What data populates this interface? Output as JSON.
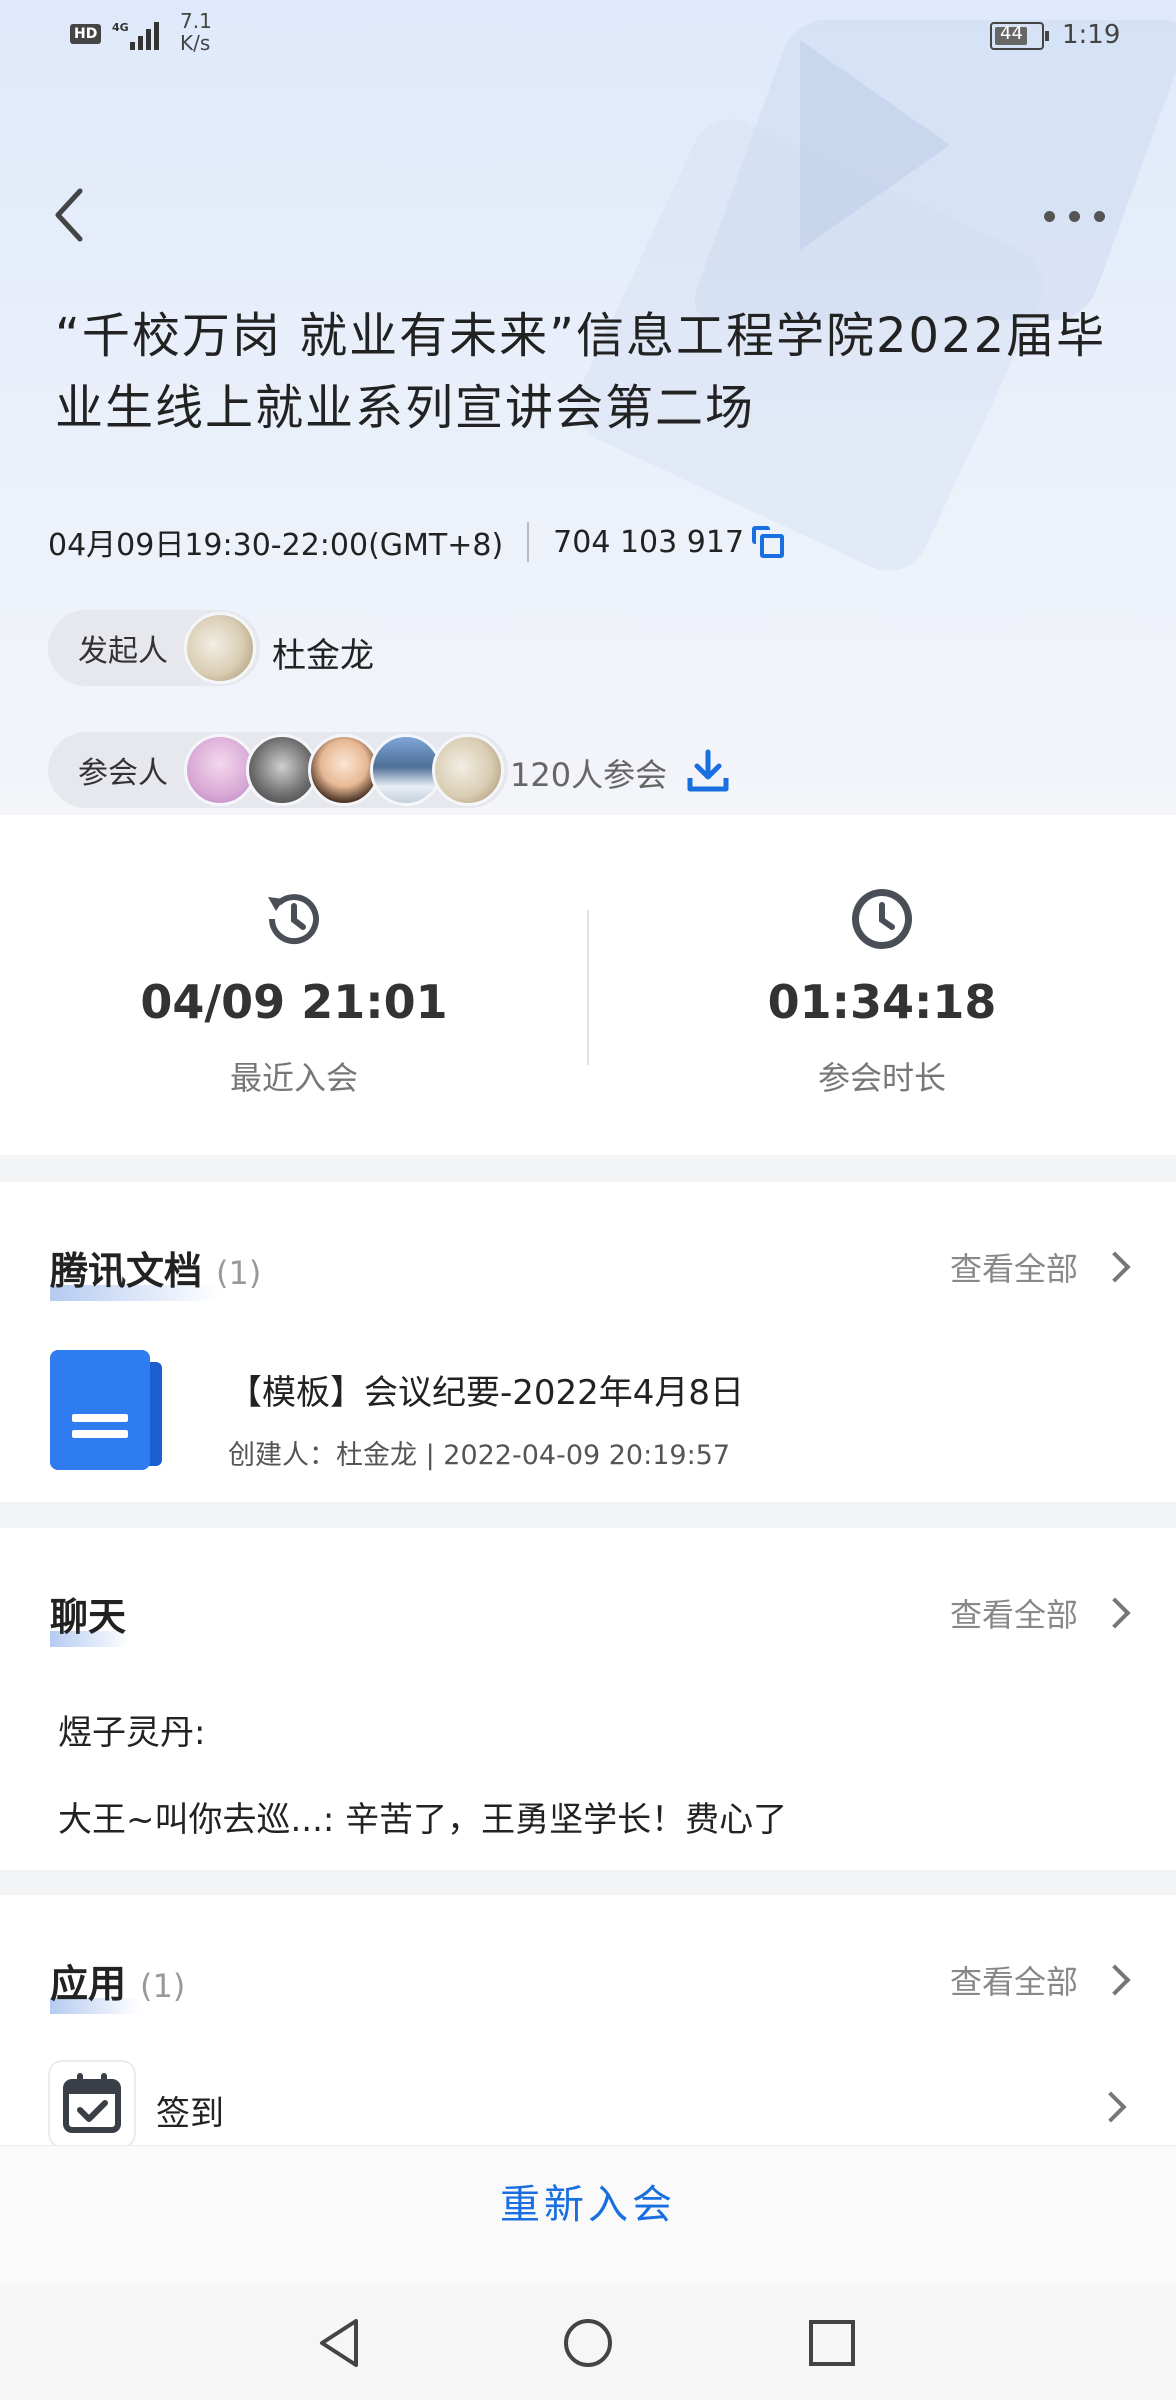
{
  "status_bar": {
    "hd": "HD",
    "network": "4G",
    "speed_value": "7.1",
    "speed_unit": "K/s",
    "battery_level": "44",
    "time": "1:19"
  },
  "meeting": {
    "title": "“千校万岗 就业有未来”信息工程学院2022届毕业生线上就业系列宣讲会第二场",
    "time_range": "04月09日19:30-22:00(GMT+8)",
    "meeting_id": "704 103 917",
    "host_label": "发起人",
    "host_name": "杜金龙",
    "participants_label": "参会人",
    "participant_count": "120人参会"
  },
  "stats": {
    "recent_join_value": "04/09 21:01",
    "recent_join_label": "最近入会",
    "duration_value": "01:34:18",
    "duration_label": "参会时长"
  },
  "docs": {
    "title": "腾讯文档",
    "count": "(1)",
    "view_all": "查看全部",
    "items": [
      {
        "name": "【模板】会议纪要-2022年4月8日",
        "meta": "创建人：杜金龙 | 2022-04-09 20:19:57"
      }
    ]
  },
  "chat": {
    "title": "聊天",
    "view_all": "查看全部",
    "messages": [
      "煜子灵丹:",
      "大王~叫你去巡...: 辛苦了，王勇坚学长！费心了"
    ]
  },
  "apps": {
    "title": "应用",
    "count": "(1)",
    "view_all": "查看全部",
    "items": [
      {
        "label": "签到",
        "icon": "checkin-calendar-icon"
      }
    ]
  },
  "actions": {
    "rejoin": "重新入会"
  },
  "colors": {
    "accent": "#1a6fe0",
    "doc_blue": "#2f7bf0"
  }
}
